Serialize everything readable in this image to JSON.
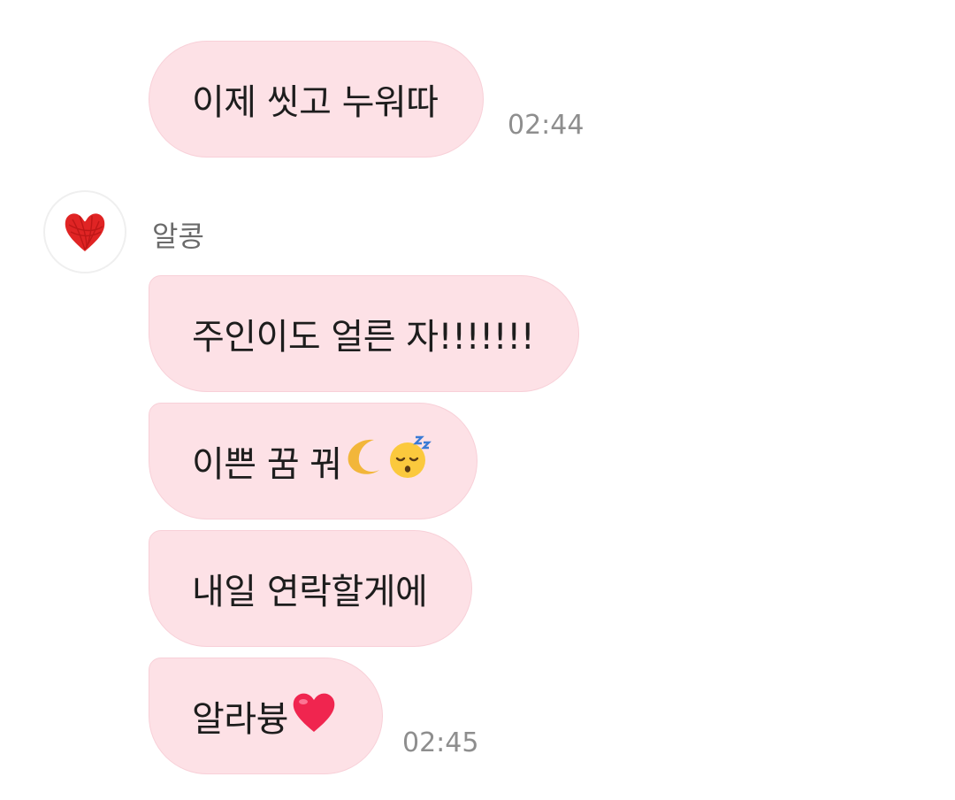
{
  "messages": {
    "m1": {
      "text": "이제 씻고 누워따",
      "time": "02:44"
    },
    "sender": {
      "name": "알콩",
      "avatar_icon": "red-heart-scribble-icon"
    },
    "m2": {
      "text": "주인이도 얼른 자!!!!!!!"
    },
    "m3": {
      "text": "이쁜 꿈 꿔",
      "emojis": [
        "crescent-moon-icon",
        "sleeping-face-icon"
      ]
    },
    "m4": {
      "text": "내일 연락할게에"
    },
    "m5": {
      "text": "알라븅",
      "emojis": [
        "red-heart-icon"
      ],
      "time": "02:45"
    }
  },
  "colors": {
    "bubble": "#fde1e6",
    "bubble_border": "#f8d0d8",
    "timestamp": "#8e8e8e",
    "sender_name": "#6b6b6b"
  }
}
